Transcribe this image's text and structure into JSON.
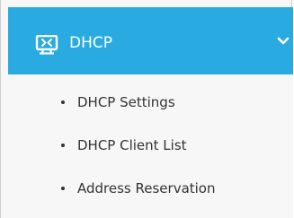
{
  "menu": {
    "header": {
      "title": "DHCP",
      "icon": "monitor-settings-icon",
      "expand_icon": "chevron-down-icon",
      "background_color": "#29abe2",
      "text_color": "#ffffff"
    },
    "items": [
      {
        "label": "DHCP Settings"
      },
      {
        "label": "DHCP Client List"
      },
      {
        "label": "Address Reservation"
      }
    ]
  }
}
